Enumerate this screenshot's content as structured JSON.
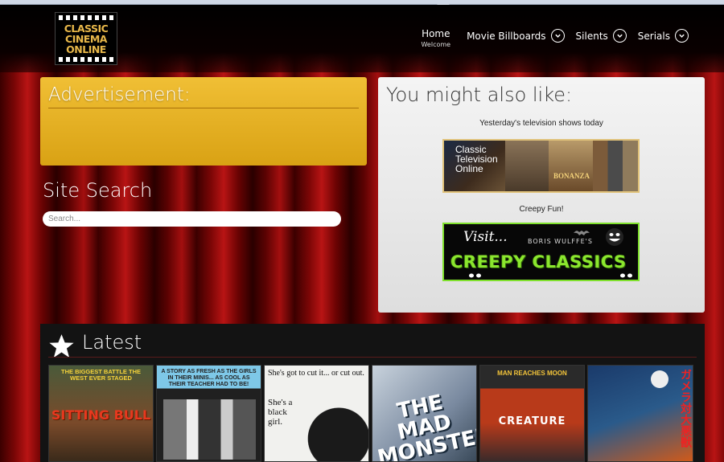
{
  "header": {
    "logo_lines": [
      "CLASSIC",
      "CINEMA",
      "ONLINE"
    ],
    "nav": [
      {
        "label": "Home",
        "sub": "Welcome"
      },
      {
        "label": "Movie Billboards"
      },
      {
        "label": "Silents"
      },
      {
        "label": "Serials"
      }
    ]
  },
  "advertisement": {
    "title": "Advertisement:"
  },
  "search": {
    "title": "Site Search",
    "placeholder": "Search..."
  },
  "sidebar": {
    "title": "You might also like:",
    "promo1": {
      "caption": "Yesterday's television shows today",
      "banner_lines": [
        "Classic",
        "Television",
        "Online"
      ],
      "banner_show": "BONANZA"
    },
    "promo2": {
      "caption": "Creepy Fun!",
      "banner_visit": "Visit...",
      "banner_author": "BORIS WULFFE'S",
      "banner_main": "CREEPY CLASSICS"
    }
  },
  "latest": {
    "title": "Latest",
    "posters": [
      {
        "headline": "THE BIGGEST BATTLE THE WEST EVER STAGED",
        "big": "SITTING BULL"
      },
      {
        "headline": "A STORY AS FRESH AS THE GIRLS IN THEIR MINIS... AS COOL AS THEIR TEACHER HAD TO BE!",
        "big": ""
      },
      {
        "headline": "She's got to cut it... or cut out.",
        "big": "She's a black girl."
      },
      {
        "headline": "",
        "big": "THE MAD MONSTER"
      },
      {
        "headline": "MAN REACHES MOON",
        "big": "CREATURE"
      },
      {
        "headline": "",
        "big": "ガメラ対大悪獣"
      }
    ]
  },
  "colors": {
    "ad_gold": "#e4ac20",
    "creepy_green": "#8be62e",
    "curtain_red": "#b81414"
  }
}
